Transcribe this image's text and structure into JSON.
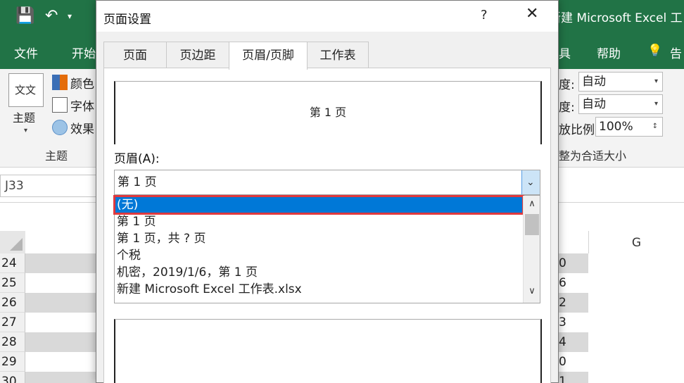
{
  "excel": {
    "title": "新建 Microsoft Excel 工",
    "menu": [
      "文件",
      "开始",
      "具",
      "帮助",
      "告"
    ],
    "ribbon": {
      "theme_label": "主题",
      "theme_icon_text": "文文",
      "colors_label": "颜色",
      "fonts_label": "字体",
      "effects_label": "效果",
      "group_theme": "主题",
      "width_label": "度:",
      "width_value": "自动",
      "height_label": "度:",
      "height_value": "自动",
      "scale_label": "放比例:",
      "scale_value": "100%",
      "group_fit": "整为合适大小"
    },
    "name_box": "J33",
    "column_g": "G",
    "rows": [
      {
        "num": "24",
        "right": "0"
      },
      {
        "num": "25",
        "right": "6"
      },
      {
        "num": "26",
        "right": "2"
      },
      {
        "num": "27",
        "right": "3"
      },
      {
        "num": "28",
        "right": "4"
      },
      {
        "num": "29",
        "right": "0"
      },
      {
        "num": "30",
        "right": "1"
      }
    ]
  },
  "dialog": {
    "title": "页面设置",
    "help": "?",
    "close": "✕",
    "tabs": [
      "页面",
      "页边距",
      "页眉/页脚",
      "工作表"
    ],
    "preview_text": "第 1 页",
    "header_label": "页眉(A):",
    "header_value": "第 1 页",
    "options": [
      "(无)",
      "第 1 页",
      "第 1 页，共 ? 页",
      "个税",
      " 机密，2019/1/6，第 1 页",
      "新建 Microsoft Excel 工作表.xlsx"
    ]
  },
  "colors": {
    "excel_green": "#217346",
    "selection_blue": "#0078d7",
    "highlight_red": "#e0393e"
  }
}
